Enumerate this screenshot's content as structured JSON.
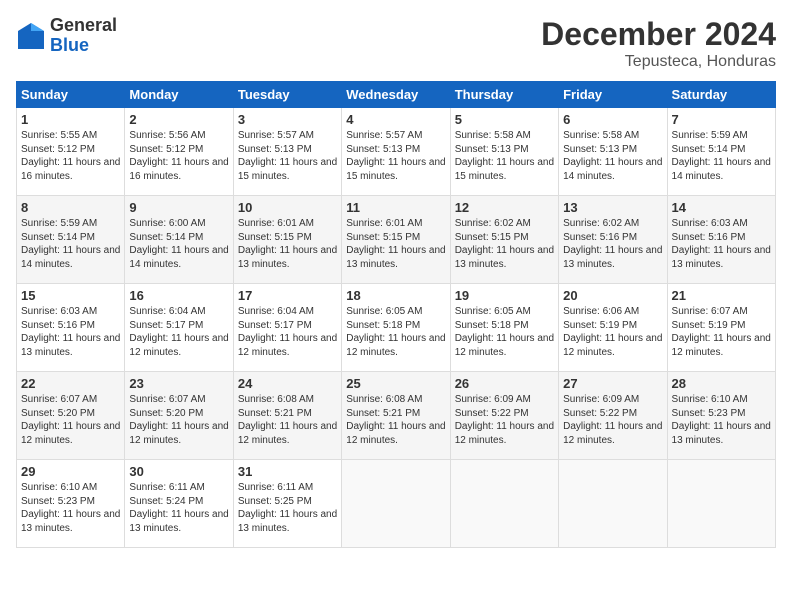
{
  "header": {
    "logo_general": "General",
    "logo_blue": "Blue",
    "title": "December 2024",
    "location": "Tepusteca, Honduras"
  },
  "columns": [
    "Sunday",
    "Monday",
    "Tuesday",
    "Wednesday",
    "Thursday",
    "Friday",
    "Saturday"
  ],
  "weeks": [
    [
      {
        "day": "1",
        "sunrise": "Sunrise: 5:55 AM",
        "sunset": "Sunset: 5:12 PM",
        "daylight": "Daylight: 11 hours and 16 minutes."
      },
      {
        "day": "2",
        "sunrise": "Sunrise: 5:56 AM",
        "sunset": "Sunset: 5:12 PM",
        "daylight": "Daylight: 11 hours and 16 minutes."
      },
      {
        "day": "3",
        "sunrise": "Sunrise: 5:57 AM",
        "sunset": "Sunset: 5:13 PM",
        "daylight": "Daylight: 11 hours and 15 minutes."
      },
      {
        "day": "4",
        "sunrise": "Sunrise: 5:57 AM",
        "sunset": "Sunset: 5:13 PM",
        "daylight": "Daylight: 11 hours and 15 minutes."
      },
      {
        "day": "5",
        "sunrise": "Sunrise: 5:58 AM",
        "sunset": "Sunset: 5:13 PM",
        "daylight": "Daylight: 11 hours and 15 minutes."
      },
      {
        "day": "6",
        "sunrise": "Sunrise: 5:58 AM",
        "sunset": "Sunset: 5:13 PM",
        "daylight": "Daylight: 11 hours and 14 minutes."
      },
      {
        "day": "7",
        "sunrise": "Sunrise: 5:59 AM",
        "sunset": "Sunset: 5:14 PM",
        "daylight": "Daylight: 11 hours and 14 minutes."
      }
    ],
    [
      {
        "day": "8",
        "sunrise": "Sunrise: 5:59 AM",
        "sunset": "Sunset: 5:14 PM",
        "daylight": "Daylight: 11 hours and 14 minutes."
      },
      {
        "day": "9",
        "sunrise": "Sunrise: 6:00 AM",
        "sunset": "Sunset: 5:14 PM",
        "daylight": "Daylight: 11 hours and 14 minutes."
      },
      {
        "day": "10",
        "sunrise": "Sunrise: 6:01 AM",
        "sunset": "Sunset: 5:15 PM",
        "daylight": "Daylight: 11 hours and 13 minutes."
      },
      {
        "day": "11",
        "sunrise": "Sunrise: 6:01 AM",
        "sunset": "Sunset: 5:15 PM",
        "daylight": "Daylight: 11 hours and 13 minutes."
      },
      {
        "day": "12",
        "sunrise": "Sunrise: 6:02 AM",
        "sunset": "Sunset: 5:15 PM",
        "daylight": "Daylight: 11 hours and 13 minutes."
      },
      {
        "day": "13",
        "sunrise": "Sunrise: 6:02 AM",
        "sunset": "Sunset: 5:16 PM",
        "daylight": "Daylight: 11 hours and 13 minutes."
      },
      {
        "day": "14",
        "sunrise": "Sunrise: 6:03 AM",
        "sunset": "Sunset: 5:16 PM",
        "daylight": "Daylight: 11 hours and 13 minutes."
      }
    ],
    [
      {
        "day": "15",
        "sunrise": "Sunrise: 6:03 AM",
        "sunset": "Sunset: 5:16 PM",
        "daylight": "Daylight: 11 hours and 13 minutes."
      },
      {
        "day": "16",
        "sunrise": "Sunrise: 6:04 AM",
        "sunset": "Sunset: 5:17 PM",
        "daylight": "Daylight: 11 hours and 12 minutes."
      },
      {
        "day": "17",
        "sunrise": "Sunrise: 6:04 AM",
        "sunset": "Sunset: 5:17 PM",
        "daylight": "Daylight: 11 hours and 12 minutes."
      },
      {
        "day": "18",
        "sunrise": "Sunrise: 6:05 AM",
        "sunset": "Sunset: 5:18 PM",
        "daylight": "Daylight: 11 hours and 12 minutes."
      },
      {
        "day": "19",
        "sunrise": "Sunrise: 6:05 AM",
        "sunset": "Sunset: 5:18 PM",
        "daylight": "Daylight: 11 hours and 12 minutes."
      },
      {
        "day": "20",
        "sunrise": "Sunrise: 6:06 AM",
        "sunset": "Sunset: 5:19 PM",
        "daylight": "Daylight: 11 hours and 12 minutes."
      },
      {
        "day": "21",
        "sunrise": "Sunrise: 6:07 AM",
        "sunset": "Sunset: 5:19 PM",
        "daylight": "Daylight: 11 hours and 12 minutes."
      }
    ],
    [
      {
        "day": "22",
        "sunrise": "Sunrise: 6:07 AM",
        "sunset": "Sunset: 5:20 PM",
        "daylight": "Daylight: 11 hours and 12 minutes."
      },
      {
        "day": "23",
        "sunrise": "Sunrise: 6:07 AM",
        "sunset": "Sunset: 5:20 PM",
        "daylight": "Daylight: 11 hours and 12 minutes."
      },
      {
        "day": "24",
        "sunrise": "Sunrise: 6:08 AM",
        "sunset": "Sunset: 5:21 PM",
        "daylight": "Daylight: 11 hours and 12 minutes."
      },
      {
        "day": "25",
        "sunrise": "Sunrise: 6:08 AM",
        "sunset": "Sunset: 5:21 PM",
        "daylight": "Daylight: 11 hours and 12 minutes."
      },
      {
        "day": "26",
        "sunrise": "Sunrise: 6:09 AM",
        "sunset": "Sunset: 5:22 PM",
        "daylight": "Daylight: 11 hours and 12 minutes."
      },
      {
        "day": "27",
        "sunrise": "Sunrise: 6:09 AM",
        "sunset": "Sunset: 5:22 PM",
        "daylight": "Daylight: 11 hours and 12 minutes."
      },
      {
        "day": "28",
        "sunrise": "Sunrise: 6:10 AM",
        "sunset": "Sunset: 5:23 PM",
        "daylight": "Daylight: 11 hours and 13 minutes."
      }
    ],
    [
      {
        "day": "29",
        "sunrise": "Sunrise: 6:10 AM",
        "sunset": "Sunset: 5:23 PM",
        "daylight": "Daylight: 11 hours and 13 minutes."
      },
      {
        "day": "30",
        "sunrise": "Sunrise: 6:11 AM",
        "sunset": "Sunset: 5:24 PM",
        "daylight": "Daylight: 11 hours and 13 minutes."
      },
      {
        "day": "31",
        "sunrise": "Sunrise: 6:11 AM",
        "sunset": "Sunset: 5:25 PM",
        "daylight": "Daylight: 11 hours and 13 minutes."
      },
      null,
      null,
      null,
      null
    ]
  ]
}
